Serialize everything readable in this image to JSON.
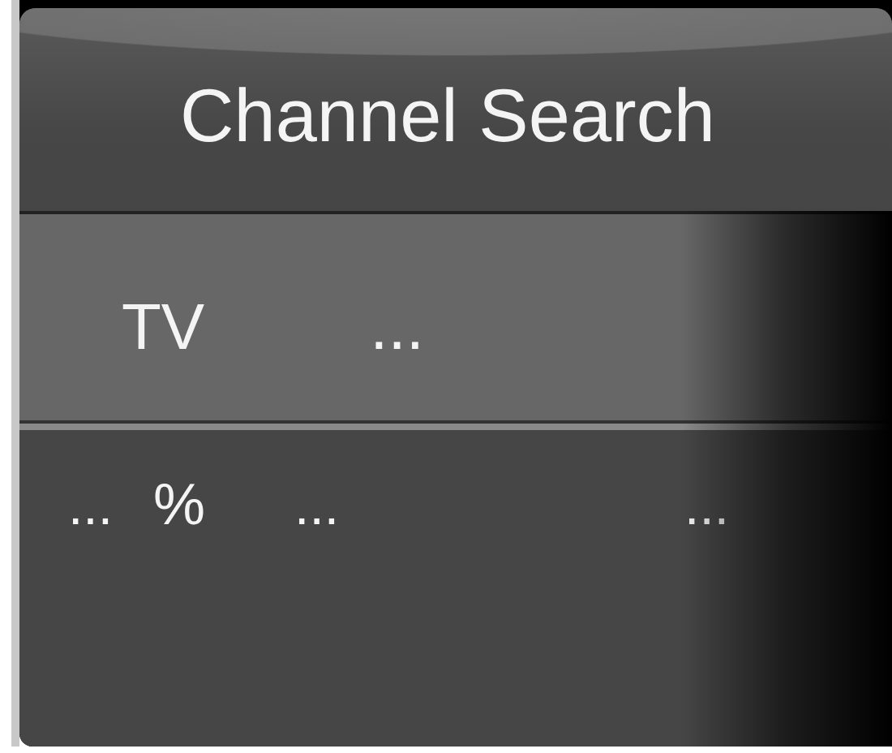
{
  "title": "Channel Search",
  "source_row": {
    "label": "TV",
    "value": "..."
  },
  "progress_row": {
    "items": [
      {
        "kind": "dots",
        "text": "..."
      },
      {
        "kind": "sign",
        "text": "%"
      },
      {
        "kind": "dots",
        "text": "..."
      },
      {
        "kind": "dots",
        "text": "..."
      }
    ]
  }
}
